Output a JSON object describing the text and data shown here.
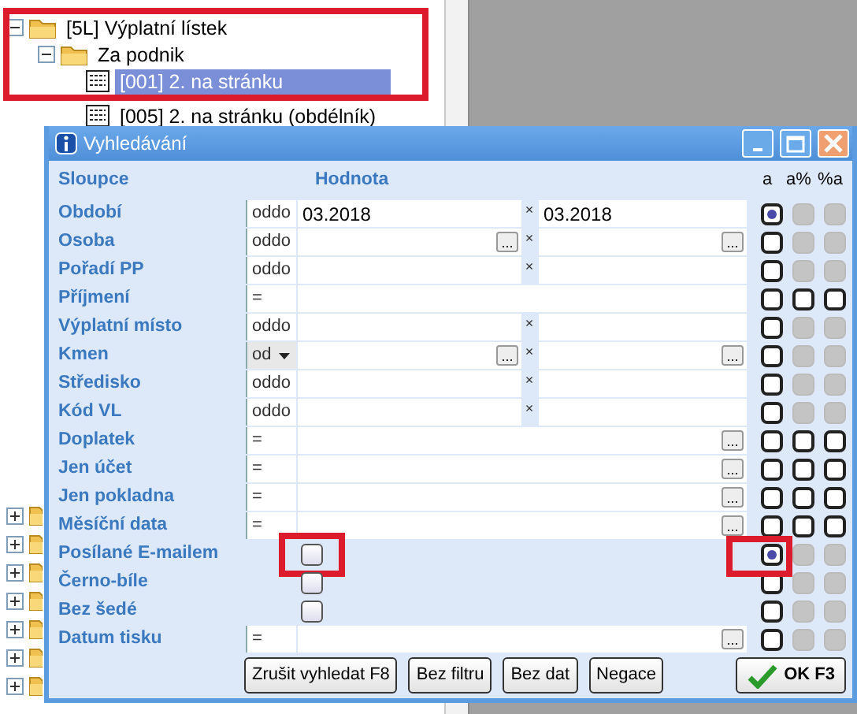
{
  "tree": [
    {
      "label": "[5L] Výplatní lístek",
      "expanded": true,
      "selected": false,
      "children": [
        {
          "label": "Za podnik",
          "expanded": true,
          "selected": false,
          "children": [
            {
              "label": "[001] 2. na stránku",
              "selected": true
            },
            {
              "label": "[005] 2. na stránku (obdélník)",
              "selected": false
            }
          ]
        }
      ]
    }
  ],
  "dialog": {
    "title": "Vyhledávání",
    "columns": {
      "name": "Sloupce",
      "value": "Hodnota",
      "match": [
        "a",
        "a%",
        "%a"
      ]
    },
    "rows": [
      {
        "kind": "range",
        "label": "Období",
        "operator": "oddo",
        "dropdown": false,
        "from": "03.2018",
        "separator": "×",
        "to": "03.2018",
        "match": [
          {
            "checked": true,
            "disabled": false
          },
          {
            "checked": false,
            "disabled": true
          },
          {
            "checked": false,
            "disabled": true
          }
        ]
      },
      {
        "kind": "range",
        "label": "Osoba",
        "operator": "oddo",
        "dropdown": false,
        "from_button": "...",
        "separator": "×",
        "to_button": "...",
        "match": [
          {
            "checked": false,
            "disabled": false
          },
          {
            "checked": false,
            "disabled": true
          },
          {
            "checked": false,
            "disabled": true
          }
        ]
      },
      {
        "kind": "range",
        "label": "Pořadí PP",
        "operator": "oddo",
        "dropdown": false,
        "separator": "×",
        "match": [
          {
            "checked": false,
            "disabled": false
          },
          {
            "checked": false,
            "disabled": true
          },
          {
            "checked": false,
            "disabled": true
          }
        ]
      },
      {
        "kind": "single",
        "label": "Příjmení",
        "operator": "=",
        "dropdown": false,
        "match": [
          {
            "checked": false,
            "disabled": false
          },
          {
            "checked": false,
            "disabled": false
          },
          {
            "checked": false,
            "disabled": false
          }
        ]
      },
      {
        "kind": "range",
        "label": "Výplatní místo",
        "operator": "oddo",
        "dropdown": false,
        "separator": "×",
        "match": [
          {
            "checked": false,
            "disabled": false
          },
          {
            "checked": false,
            "disabled": true
          },
          {
            "checked": false,
            "disabled": true
          }
        ]
      },
      {
        "kind": "range",
        "label": "Kmen",
        "operator": "od",
        "dropdown": true,
        "from_button": "...",
        "separator": "×",
        "to_button": "...",
        "match": [
          {
            "checked": false,
            "disabled": false
          },
          {
            "checked": false,
            "disabled": true
          },
          {
            "checked": false,
            "disabled": true
          }
        ]
      },
      {
        "kind": "range",
        "label": "Středisko",
        "operator": "oddo",
        "dropdown": false,
        "separator": "×",
        "match": [
          {
            "checked": false,
            "disabled": false
          },
          {
            "checked": false,
            "disabled": true
          },
          {
            "checked": false,
            "disabled": true
          }
        ]
      },
      {
        "kind": "range",
        "label": "Kód VL",
        "operator": "oddo",
        "dropdown": false,
        "separator": "×",
        "match": [
          {
            "checked": false,
            "disabled": false
          },
          {
            "checked": false,
            "disabled": true
          },
          {
            "checked": false,
            "disabled": true
          }
        ]
      },
      {
        "kind": "single",
        "label": "Doplatek",
        "operator": "=",
        "dropdown": false,
        "button": "...",
        "match": [
          {
            "checked": false,
            "disabled": false
          },
          {
            "checked": false,
            "disabled": false
          },
          {
            "checked": false,
            "disabled": false
          }
        ]
      },
      {
        "kind": "single",
        "label": "Jen účet",
        "operator": "=",
        "dropdown": false,
        "button": "...",
        "match": [
          {
            "checked": false,
            "disabled": false
          },
          {
            "checked": false,
            "disabled": false
          },
          {
            "checked": false,
            "disabled": false
          }
        ]
      },
      {
        "kind": "single",
        "label": "Jen pokladna",
        "operator": "=",
        "dropdown": false,
        "button": "...",
        "match": [
          {
            "checked": false,
            "disabled": false
          },
          {
            "checked": false,
            "disabled": false
          },
          {
            "checked": false,
            "disabled": false
          }
        ]
      },
      {
        "kind": "single",
        "label": "Měsíční data",
        "operator": "=",
        "dropdown": false,
        "button": "...",
        "match": [
          {
            "checked": false,
            "disabled": false
          },
          {
            "checked": false,
            "disabled": false
          },
          {
            "checked": false,
            "disabled": false
          }
        ]
      },
      {
        "kind": "checkbox",
        "label": "Posílané E-mailem",
        "checked": false,
        "highlighted": true,
        "match": [
          {
            "checked": true,
            "disabled": false
          },
          {
            "checked": false,
            "disabled": true
          },
          {
            "checked": false,
            "disabled": true
          }
        ]
      },
      {
        "kind": "checkbox",
        "label": "Černo-bíle",
        "checked": false,
        "highlighted": false,
        "match": [
          {
            "checked": false,
            "disabled": false
          },
          {
            "checked": false,
            "disabled": true
          },
          {
            "checked": false,
            "disabled": true
          }
        ]
      },
      {
        "kind": "checkbox",
        "label": "Bez šedé",
        "checked": false,
        "highlighted": false,
        "match": [
          {
            "checked": false,
            "disabled": false
          },
          {
            "checked": false,
            "disabled": true
          },
          {
            "checked": false,
            "disabled": true
          }
        ]
      },
      {
        "kind": "single",
        "label": "Datum tisku",
        "operator": "=",
        "dropdown": false,
        "button": "...",
        "match": [
          {
            "checked": false,
            "disabled": false
          },
          {
            "checked": false,
            "disabled": true
          },
          {
            "checked": false,
            "disabled": true
          }
        ]
      }
    ],
    "buttons": [
      {
        "label": "Zrušit vyhledat F8",
        "kind": "plain"
      },
      {
        "label": "Bez filtru",
        "kind": "plain"
      },
      {
        "label": "Bez dat",
        "kind": "plain"
      },
      {
        "label": "Negace",
        "kind": "plain"
      },
      {
        "label": "OK F3",
        "kind": "ok"
      }
    ]
  }
}
